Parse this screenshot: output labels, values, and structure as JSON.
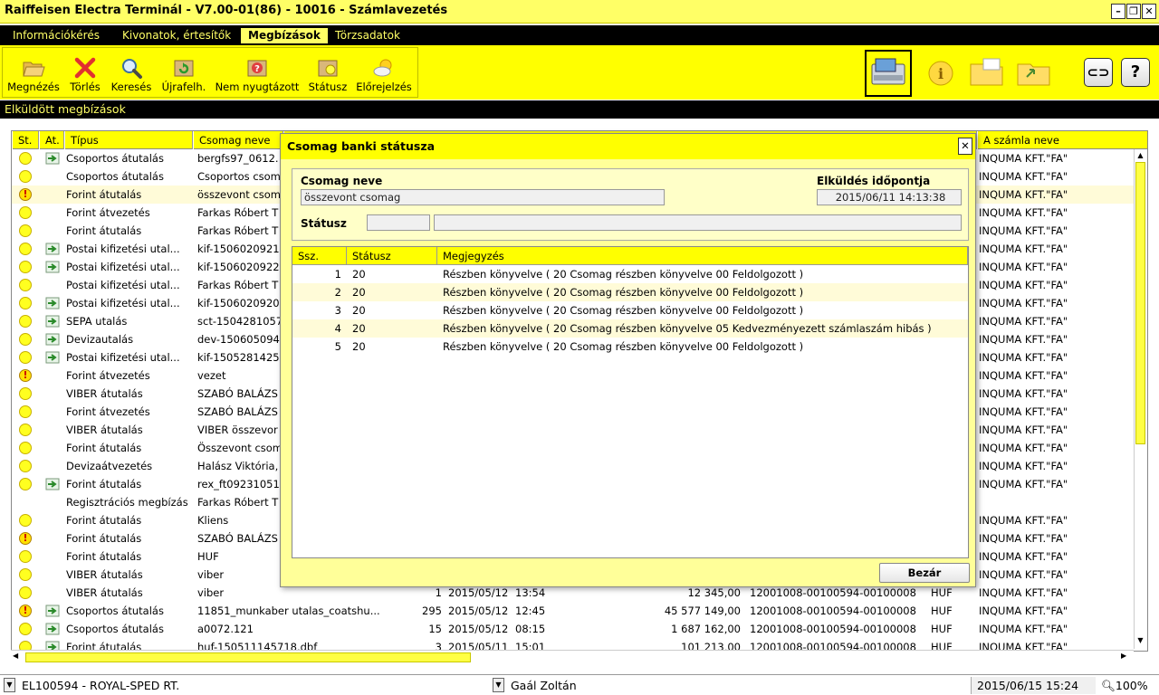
{
  "window": {
    "title": "Raiffeisen Electra Terminál - V7.00-01(86) - 10016 - Számlavezetés"
  },
  "menu": [
    "Információkérés",
    "Kivonatok, értesítők",
    "Megbízások",
    "Törzsadatok"
  ],
  "toolbar": {
    "buttons": [
      {
        "label": "Megnézés",
        "icon": "folder-open-icon"
      },
      {
        "label": "Törlés",
        "icon": "delete-x-icon"
      },
      {
        "label": "Keresés",
        "icon": "magnifier-icon"
      },
      {
        "label": "Újrafelh.",
        "icon": "recycle-icon"
      },
      {
        "label": "Nem nyugtázott",
        "icon": "question-box-icon"
      },
      {
        "label": "Státusz",
        "icon": "status-box-icon"
      },
      {
        "label": "Előrejelzés",
        "icon": "weather-forecast-icon"
      }
    ],
    "right_icons": [
      "transfer-module-icon",
      "info-module-icon",
      "folder-module-icon",
      "exchange-module-icon"
    ],
    "side_buttons": [
      "link-icon",
      "?"
    ]
  },
  "section": {
    "title": "Elküldött megbízások"
  },
  "grid": {
    "headers": [
      "St.",
      "At.",
      "Típus",
      "Csomag neve",
      "A számla neve"
    ],
    "rows": [
      {
        "st": "ok",
        "at": true,
        "type": "Csoportos átutalás",
        "pkg": "bergfs97_0612.",
        "tail": "",
        "name": "INQUMA KFT.\"FA\""
      },
      {
        "st": "ok",
        "at": false,
        "type": "Csoportos átutalás",
        "pkg": "Csoportos csom",
        "tail": "",
        "name": "INQUMA KFT.\"FA\""
      },
      {
        "st": "warn",
        "at": false,
        "type": "Forint átutalás",
        "pkg": "összevont csom",
        "tail": "",
        "name": "INQUMA KFT.\"FA\""
      },
      {
        "st": "ok",
        "at": false,
        "type": "Forint átvezetés",
        "pkg": "Farkas Róbert T",
        "tail": "",
        "name": "INQUMA KFT.\"FA\""
      },
      {
        "st": "ok",
        "at": false,
        "type": "Forint átutalás",
        "pkg": "Farkas Róbert T",
        "tail": "",
        "name": "INQUMA KFT.\"FA\""
      },
      {
        "st": "ok",
        "at": true,
        "type": "Postai kifizetési utal...",
        "pkg": "kif-1506020921",
        "tail": "",
        "name": "INQUMA KFT.\"FA\""
      },
      {
        "st": "ok",
        "at": true,
        "type": "Postai kifizetési utal...",
        "pkg": "kif-1506020922",
        "tail": "",
        "name": "INQUMA KFT.\"FA\""
      },
      {
        "st": "ok",
        "at": false,
        "type": "Postai kifizetési utal...",
        "pkg": "Farkas Róbert T",
        "tail": "",
        "name": "INQUMA KFT.\"FA\""
      },
      {
        "st": "ok",
        "at": true,
        "type": "Postai kifizetési utal...",
        "pkg": "kif-1506020920",
        "tail": "",
        "name": "INQUMA KFT.\"FA\""
      },
      {
        "st": "ok",
        "at": true,
        "type": "SEPA utalás",
        "pkg": "sct-1504281057",
        "tail": "",
        "name": "INQUMA KFT.\"FA\""
      },
      {
        "st": "ok",
        "at": true,
        "type": "Devizautalás",
        "pkg": "dev-150605094",
        "tail": "",
        "name": "INQUMA KFT.\"FA\""
      },
      {
        "st": "ok",
        "at": true,
        "type": "Postai kifizetési utal...",
        "pkg": "kif-1505281425",
        "tail": "",
        "name": "INQUMA KFT.\"FA\""
      },
      {
        "st": "warn",
        "at": false,
        "type": "Forint átvezetés",
        "pkg": "vezet",
        "tail": "",
        "name": "INQUMA KFT.\"FA\""
      },
      {
        "st": "ok",
        "at": false,
        "type": "VIBER átutalás",
        "pkg": "SZABÓ BALÁZS",
        "tail": "",
        "name": "INQUMA KFT.\"FA\""
      },
      {
        "st": "ok",
        "at": false,
        "type": "Forint átvezetés",
        "pkg": "SZABÓ BALÁZS",
        "tail": "",
        "name": "INQUMA KFT.\"FA\""
      },
      {
        "st": "ok",
        "at": false,
        "type": "VIBER átutalás",
        "pkg": "VIBER összevor",
        "tail": "",
        "name": "INQUMA KFT.\"FA\""
      },
      {
        "st": "ok",
        "at": false,
        "type": "Forint átutalás",
        "pkg": "Összevont csom",
        "tail": "",
        "name": "INQUMA KFT.\"FA\""
      },
      {
        "st": "ok",
        "at": false,
        "type": "Devizaátvezetés",
        "pkg": "Halász Viktória,",
        "tail": "",
        "name": "INQUMA KFT.\"FA\""
      },
      {
        "st": "ok",
        "at": true,
        "type": "Forint átutalás",
        "pkg": "rex_ft09231051",
        "tail": "",
        "name": "INQUMA KFT.\"FA\""
      },
      {
        "st": "none",
        "at": false,
        "type": "Regisztrációs megbízás",
        "pkg": "Farkas Róbert T",
        "tail": "",
        "name": ""
      },
      {
        "st": "ok",
        "at": false,
        "type": "Forint átutalás",
        "pkg": "Kliens",
        "tail": "",
        "name": "INQUMA KFT.\"FA\""
      },
      {
        "st": "warn",
        "at": false,
        "type": "Forint átutalás",
        "pkg": "SZABÓ BALÁZS",
        "tail": "",
        "name": "INQUMA KFT.\"FA\""
      },
      {
        "st": "ok",
        "at": false,
        "type": "Forint átutalás",
        "pkg": "HUF",
        "tail": "",
        "name": "INQUMA KFT.\"FA\""
      },
      {
        "st": "ok",
        "at": false,
        "type": "VIBER átutalás",
        "pkg": "viber",
        "tail": "",
        "name": "INQUMA KFT.\"FA\""
      },
      {
        "st": "ok",
        "at": false,
        "type": "VIBER átutalás",
        "pkg": "viber",
        "count": "1",
        "date": "2015/05/12",
        "time": "13:54",
        "amount": "12 345,00",
        "account": "12001008-00100594-00100008",
        "cur": "HUF",
        "name": "INQUMA KFT.\"FA\""
      },
      {
        "st": "warn",
        "at": true,
        "type": "Csoportos átutalás",
        "pkg": "11851_munkaber utalas_coatshu...",
        "count": "295",
        "date": "2015/05/12",
        "time": "12:45",
        "amount": "45 577 149,00",
        "account": "12001008-00100594-00100008",
        "cur": "HUF",
        "name": "INQUMA KFT.\"FA\""
      },
      {
        "st": "ok",
        "at": true,
        "type": "Csoportos átutalás",
        "pkg": "a0072.121",
        "count": "15",
        "date": "2015/05/12",
        "time": "08:15",
        "amount": "1 687 162,00",
        "account": "12001008-00100594-00100008",
        "cur": "HUF",
        "name": "INQUMA KFT.\"FA\""
      },
      {
        "st": "ok",
        "at": true,
        "type": "Forint átutalás",
        "pkg": "huf-150511145718.dbf",
        "count": "3",
        "date": "2015/05/11",
        "time": "15:01",
        "amount": "101 213,00",
        "account": "12001008-00100594-00100008",
        "cur": "HUF",
        "name": "INQUMA KFT.\"FA\""
      }
    ]
  },
  "dialog": {
    "title": "Csomag banki státusza",
    "close": "✕",
    "pkg_label": "Csomag neve",
    "pkg_value": "összevont csomag",
    "sent_label": "Elküldés időpontja",
    "sent_value": "2015/06/11 14:13:38",
    "status_label": "Státusz",
    "status_code": "",
    "status_text": "",
    "headers": [
      "Ssz.",
      "Státusz",
      "Megjegyzés"
    ],
    "rows": [
      {
        "n": "1",
        "s": "20",
        "m": "Részben könyvelve ( 20 Csomag részben könyvelve 00 Feldolgozott )"
      },
      {
        "n": "2",
        "s": "20",
        "m": "Részben könyvelve ( 20 Csomag részben könyvelve 00 Feldolgozott )"
      },
      {
        "n": "3",
        "s": "20",
        "m": "Részben könyvelve ( 20 Csomag részben könyvelve 00 Feldolgozott )"
      },
      {
        "n": "4",
        "s": "20",
        "m": "Részben könyvelve ( 20 Csomag részben könyvelve 05 Kedvezményezett számlaszám hibás )"
      },
      {
        "n": "5",
        "s": "20",
        "m": "Részben könyvelve ( 20 Csomag részben könyvelve 00 Feldolgozott )"
      }
    ],
    "close_button": "Bezár"
  },
  "statusbar": {
    "account": "EL100594 - ROYAL-SPED RT.",
    "user": "Gaál Zoltán",
    "datetime": "2015/06/15 15:24",
    "zoom": "100%"
  }
}
